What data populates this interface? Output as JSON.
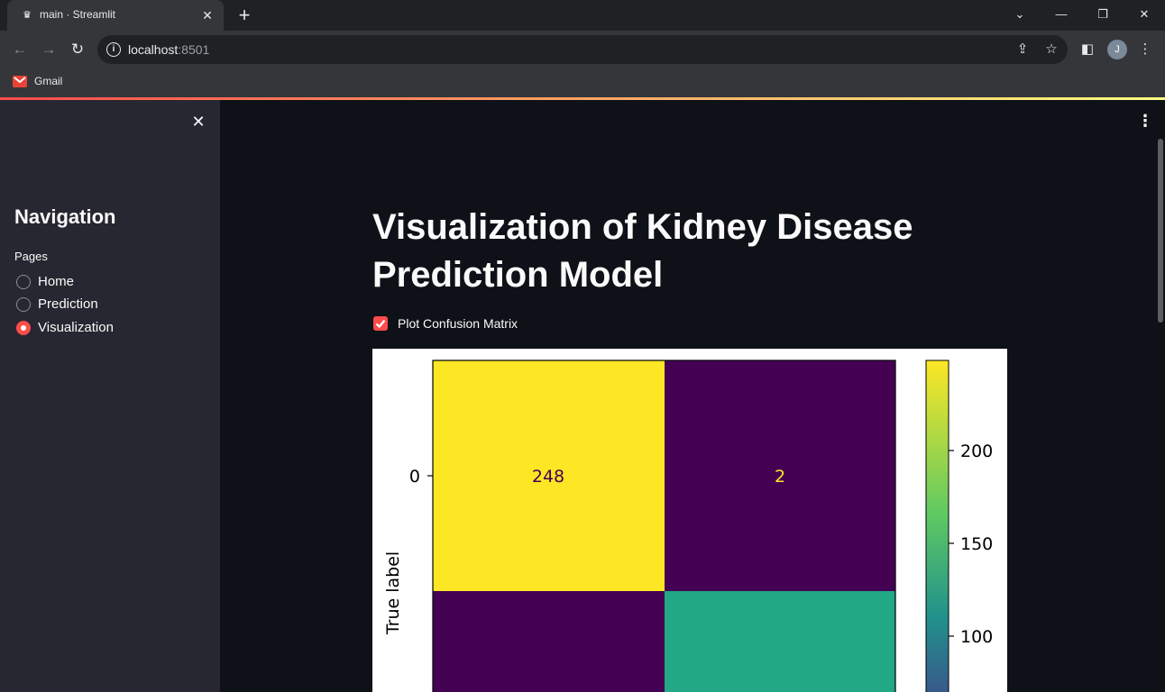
{
  "browser": {
    "tab_title": "main · Streamlit",
    "url_host": "localhost",
    "url_port": ":8501",
    "bookmark": "Gmail",
    "profile_initial": "J"
  },
  "sidebar": {
    "title": "Navigation",
    "group_label": "Pages",
    "items": [
      {
        "label": "Home",
        "selected": false
      },
      {
        "label": "Prediction",
        "selected": false
      },
      {
        "label": "Visualization",
        "selected": true
      }
    ]
  },
  "main": {
    "title": "Visualization of Kidney Disease Prediction Model",
    "checkbox_label": "Plot Confusion Matrix",
    "checkbox_checked": true
  },
  "colors": {
    "accent": "#ff4b4b",
    "background": "#0e1117",
    "sidebar": "#262730"
  },
  "chart_data": {
    "type": "heatmap",
    "title": "",
    "ylabel": "True label",
    "row_ticks": [
      "0"
    ],
    "cells": [
      {
        "row": 0,
        "col": 0,
        "value": 248
      },
      {
        "row": 0,
        "col": 1,
        "value": 2
      }
    ],
    "cell_colors": [
      [
        "#fde725",
        "#440154"
      ],
      [
        "#440154",
        "#22a884"
      ]
    ],
    "colorbar_ticks": [
      200,
      150,
      100
    ]
  }
}
